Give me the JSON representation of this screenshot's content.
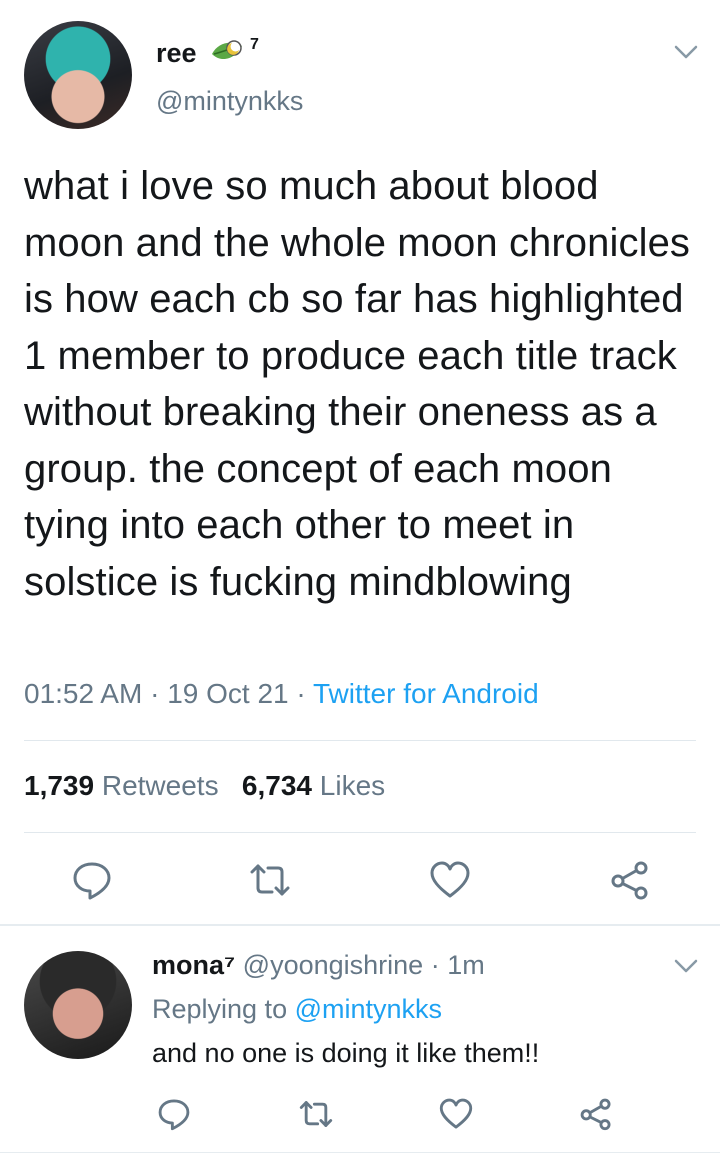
{
  "tweet": {
    "author_name": "ree",
    "author_badge_sup": "7",
    "author_handle": "@mintynkks",
    "badge_icon": "leaf-moon-emoji-icon",
    "text": "what i love so much about blood moon and the whole moon chronicles is how each cb so far has highlighted 1 member to produce each title track without breaking their oneness as a group. the concept of each moon tying into each other to meet in solstice is fucking mindblowing",
    "time": "01:52 AM",
    "date": "19 Oct 21",
    "separator": "·",
    "source": "Twitter for Android",
    "retweets_count": "1,739",
    "retweets_label": "Retweets",
    "likes_count": "6,734",
    "likes_label": "Likes",
    "icons": [
      "reply-icon",
      "retweet-icon",
      "like-icon",
      "share-icon"
    ]
  },
  "reply": {
    "author_name": "mona⁷",
    "author_handle": "@yoongishrine",
    "time_ago": "1m",
    "separator": "·",
    "replying_prefix": "Replying to",
    "replying_to": "@mintynkks",
    "text": "and no one is doing it like them!!",
    "icons": [
      "reply-icon",
      "retweet-icon",
      "like-icon",
      "share-icon"
    ]
  },
  "colors": {
    "text": "#14171a",
    "secondary": "#657786",
    "accent": "#1da1f2",
    "divider": "#e1e8ed"
  }
}
